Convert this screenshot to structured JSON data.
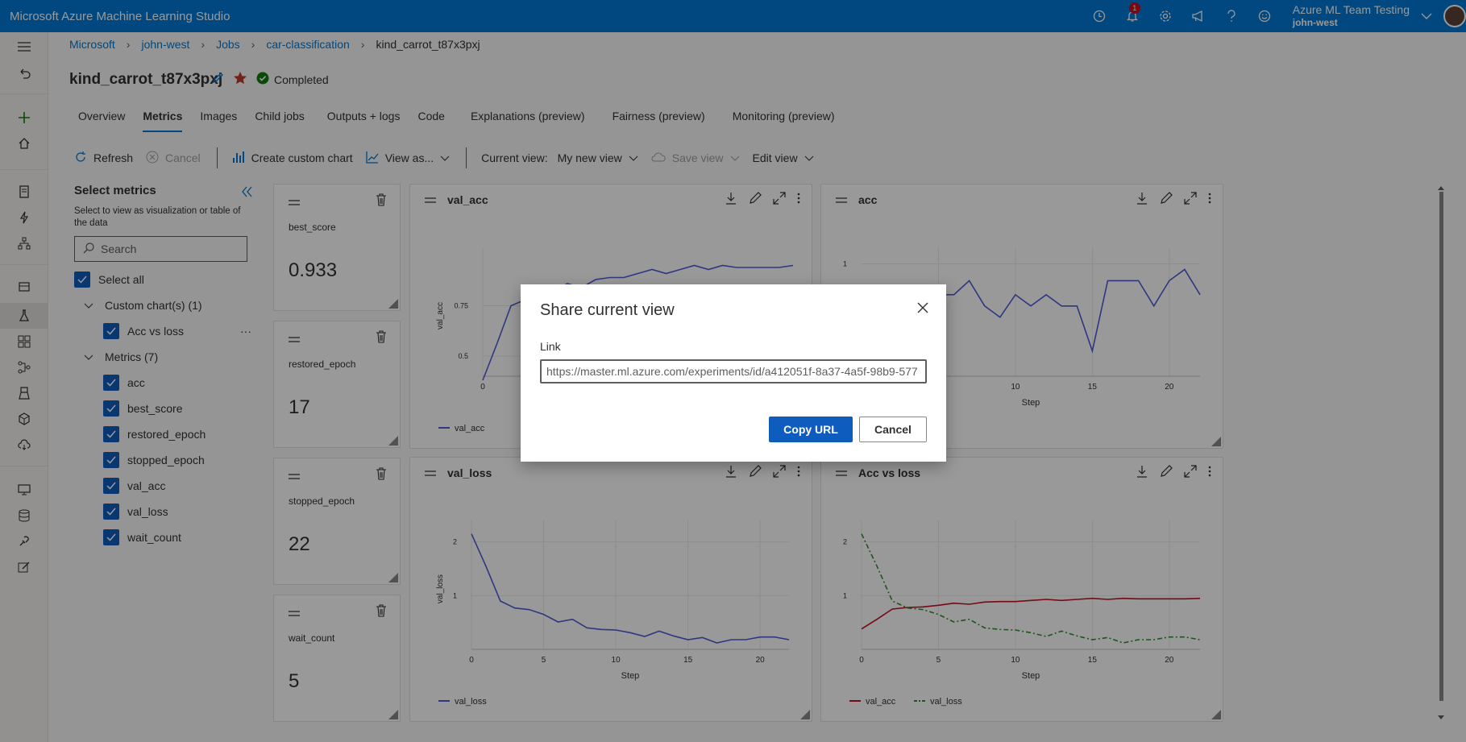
{
  "app": {
    "title": "Microsoft Azure Machine Learning Studio",
    "notification_count": "1",
    "workspace": "Azure ML Team Testing",
    "user": "john-west"
  },
  "breadcrumb": [
    "Microsoft",
    "john-west",
    "Jobs",
    "car-classification",
    "kind_carrot_t87x3pxj"
  ],
  "job": {
    "name": "kind_carrot_t87x3pxj",
    "status": "Completed"
  },
  "tabs": [
    "Overview",
    "Metrics",
    "Images",
    "Child jobs",
    "Outputs + logs",
    "Code",
    "Explanations (preview)",
    "Fairness (preview)",
    "Monitoring (preview)"
  ],
  "active_tab": "Metrics",
  "toolbar": {
    "refresh": "Refresh",
    "cancel": "Cancel",
    "create_chart": "Create custom chart",
    "view_as": "View as...",
    "current_view_label": "Current view:",
    "current_view": "My new view",
    "save_view": "Save view",
    "edit_view": "Edit view"
  },
  "sidebar": {
    "title": "Select metrics",
    "subtitle": "Select to view as visualization or table of the data",
    "search_placeholder": "Search",
    "select_all": "Select all",
    "custom_group": "Custom chart(s) (1)",
    "custom_items": [
      "Acc vs loss"
    ],
    "metrics_group": "Metrics (7)",
    "metrics": [
      "acc",
      "best_score",
      "restored_epoch",
      "stopped_epoch",
      "val_acc",
      "val_loss",
      "wait_count"
    ]
  },
  "metric_cards": [
    {
      "name": "best_score",
      "value": "0.933"
    },
    {
      "name": "restored_epoch",
      "value": "17"
    },
    {
      "name": "stopped_epoch",
      "value": "22"
    },
    {
      "name": "wait_count",
      "value": "5"
    }
  ],
  "chart_data": [
    {
      "type": "line",
      "title": "val_acc",
      "ylabel": "val_acc",
      "xlabel": "",
      "x": [
        0,
        1,
        2,
        3,
        4,
        5,
        6,
        7,
        8,
        9,
        10,
        11,
        12,
        13,
        14,
        15,
        16,
        17,
        18,
        19,
        20,
        21,
        22
      ],
      "series": [
        {
          "name": "val_acc",
          "color": "#4e5dd6",
          "values": [
            0.38,
            0.56,
            0.75,
            0.78,
            0.79,
            0.82,
            0.86,
            0.84,
            0.88,
            0.89,
            0.89,
            0.91,
            0.93,
            0.91,
            0.93,
            0.95,
            0.93,
            0.95,
            0.94,
            0.94,
            0.94,
            0.94,
            0.95
          ]
        }
      ],
      "xticks": [
        0
      ],
      "yticks": [
        0.5,
        0.75
      ],
      "ylim": [
        0.4,
        1.0
      ],
      "xlim": [
        0,
        22
      ]
    },
    {
      "type": "line",
      "title": "acc",
      "ylabel": "",
      "xlabel": "Step",
      "x": [
        4,
        5,
        6,
        7,
        8,
        9,
        10,
        11,
        12,
        13,
        14,
        15,
        16,
        17,
        18,
        19,
        20,
        21,
        22
      ],
      "series": [
        {
          "name": "acc",
          "color": "#4e5dd6",
          "values": [
            0.89,
            0.89,
            0.89,
            0.94,
            0.85,
            0.81,
            0.89,
            0.85,
            0.89,
            0.85,
            0.85,
            0.69,
            0.94,
            0.94,
            0.94,
            0.85,
            0.94,
            0.98,
            0.89
          ]
        }
      ],
      "xticks": [
        5,
        10,
        15,
        20
      ],
      "yticks": [
        1
      ],
      "ylim": [
        0.6,
        1.03
      ],
      "xlim": [
        0,
        22
      ]
    },
    {
      "type": "line",
      "title": "val_loss",
      "ylabel": "val_loss",
      "xlabel": "Step",
      "x": [
        0,
        1,
        2,
        3,
        4,
        5,
        6,
        7,
        8,
        9,
        10,
        11,
        12,
        13,
        14,
        15,
        16,
        17,
        18,
        19,
        20,
        21,
        22
      ],
      "series": [
        {
          "name": "val_loss",
          "color": "#4e5dd6",
          "values": [
            2.15,
            1.55,
            0.9,
            0.77,
            0.74,
            0.65,
            0.51,
            0.56,
            0.4,
            0.37,
            0.36,
            0.31,
            0.24,
            0.34,
            0.25,
            0.18,
            0.22,
            0.12,
            0.18,
            0.18,
            0.23,
            0.23,
            0.18
          ]
        }
      ],
      "xticks": [
        0,
        5,
        10,
        15,
        20
      ],
      "yticks": [
        1,
        2
      ],
      "ylim": [
        0,
        2.25
      ],
      "xlim": [
        0,
        22
      ]
    },
    {
      "type": "line",
      "title": "Acc vs loss",
      "ylabel": "",
      "xlabel": "Step",
      "x": [
        0,
        1,
        2,
        3,
        4,
        5,
        6,
        7,
        8,
        9,
        10,
        11,
        12,
        13,
        14,
        15,
        16,
        17,
        18,
        19,
        20,
        21,
        22
      ],
      "series": [
        {
          "name": "val_acc",
          "color": "#c50f1f",
          "values": [
            0.38,
            0.56,
            0.75,
            0.78,
            0.79,
            0.82,
            0.86,
            0.84,
            0.88,
            0.89,
            0.89,
            0.91,
            0.93,
            0.91,
            0.93,
            0.95,
            0.93,
            0.95,
            0.94,
            0.94,
            0.94,
            0.94,
            0.95
          ]
        },
        {
          "name": "val_loss",
          "color": "#2f8f2f",
          "values": [
            2.15,
            1.55,
            0.9,
            0.77,
            0.74,
            0.65,
            0.51,
            0.56,
            0.4,
            0.37,
            0.36,
            0.31,
            0.24,
            0.34,
            0.25,
            0.18,
            0.22,
            0.12,
            0.18,
            0.18,
            0.23,
            0.23,
            0.18
          ]
        }
      ],
      "xticks": [
        0,
        5,
        10,
        15,
        20
      ],
      "yticks": [
        1,
        2
      ],
      "ylim": [
        0,
        2.25
      ],
      "xlim": [
        0,
        22
      ]
    }
  ],
  "dialog": {
    "title": "Share current view",
    "link_label": "Link",
    "url": "https://master.ml.azure.com/experiments/id/a412051f-8a37-4a5f-98b9-577",
    "copy_button": "Copy URL",
    "cancel_button": "Cancel"
  }
}
